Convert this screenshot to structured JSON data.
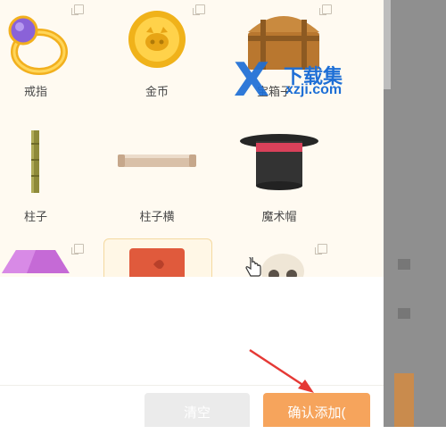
{
  "items": [
    {
      "label": "戒指",
      "icon": "ring-icon"
    },
    {
      "label": "金币",
      "icon": "gold-coin-icon"
    },
    {
      "label": "宝箱子",
      "icon": "treasure-chest-icon"
    },
    {
      "label": "柱子",
      "icon": "pillar-icon"
    },
    {
      "label": "柱子横",
      "icon": "horizontal-pillar-icon"
    },
    {
      "label": "魔术帽",
      "icon": "magic-hat-icon"
    },
    {
      "label": "",
      "icon": "purple-gem-icon"
    },
    {
      "label": "",
      "icon": "red-block-icon",
      "selected": true
    },
    {
      "label": "",
      "icon": "skull-icon"
    }
  ],
  "buttons": {
    "clear_label": "清空",
    "confirm_label": "确认添加("
  },
  "watermark": {
    "x": "X",
    "name": "下载集",
    "url": "xzji.com"
  },
  "colors": {
    "panel_bg": "#fffaf1",
    "confirm": "#f6a45c",
    "clear": "#ebebeb",
    "arrow": "#e53935",
    "watermark": "#1e6fd6"
  }
}
